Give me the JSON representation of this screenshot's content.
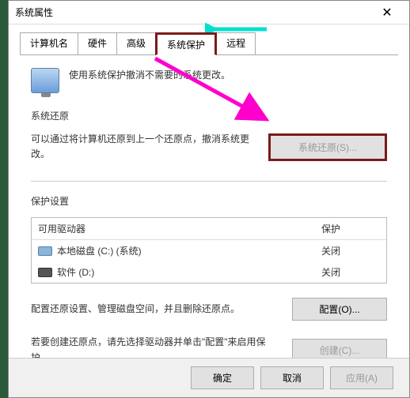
{
  "window": {
    "title": "系统属性"
  },
  "tabs": [
    {
      "label": "计算机名"
    },
    {
      "label": "硬件"
    },
    {
      "label": "高级"
    },
    {
      "label": "系统保护"
    },
    {
      "label": "远程"
    }
  ],
  "intro": "使用系统保护撤消不需要的系统更改。",
  "restore": {
    "header": "系统还原",
    "text": "可以通过将计算机还原到上一个还原点，撤消系统更改。",
    "button": "系统还原(S)..."
  },
  "protection": {
    "header": "保护设置",
    "columns": {
      "drive": "可用驱动器",
      "status": "保护"
    },
    "rows": [
      {
        "label": "本地磁盘 (C:) (系统)",
        "status": "关闭",
        "iconClass": ""
      },
      {
        "label": "软件 (D:)",
        "status": "关闭",
        "iconClass": "dark"
      }
    ],
    "configText": "配置还原设置、管理磁盘空间，并且删除还原点。",
    "configButton": "配置(O)...",
    "createText": "若要创建还原点，请先选择驱动器并单击\"配置\"来启用保护。",
    "createButton": "创建(C)..."
  },
  "footer": {
    "ok": "确定",
    "cancel": "取消",
    "apply": "应用(A)"
  }
}
